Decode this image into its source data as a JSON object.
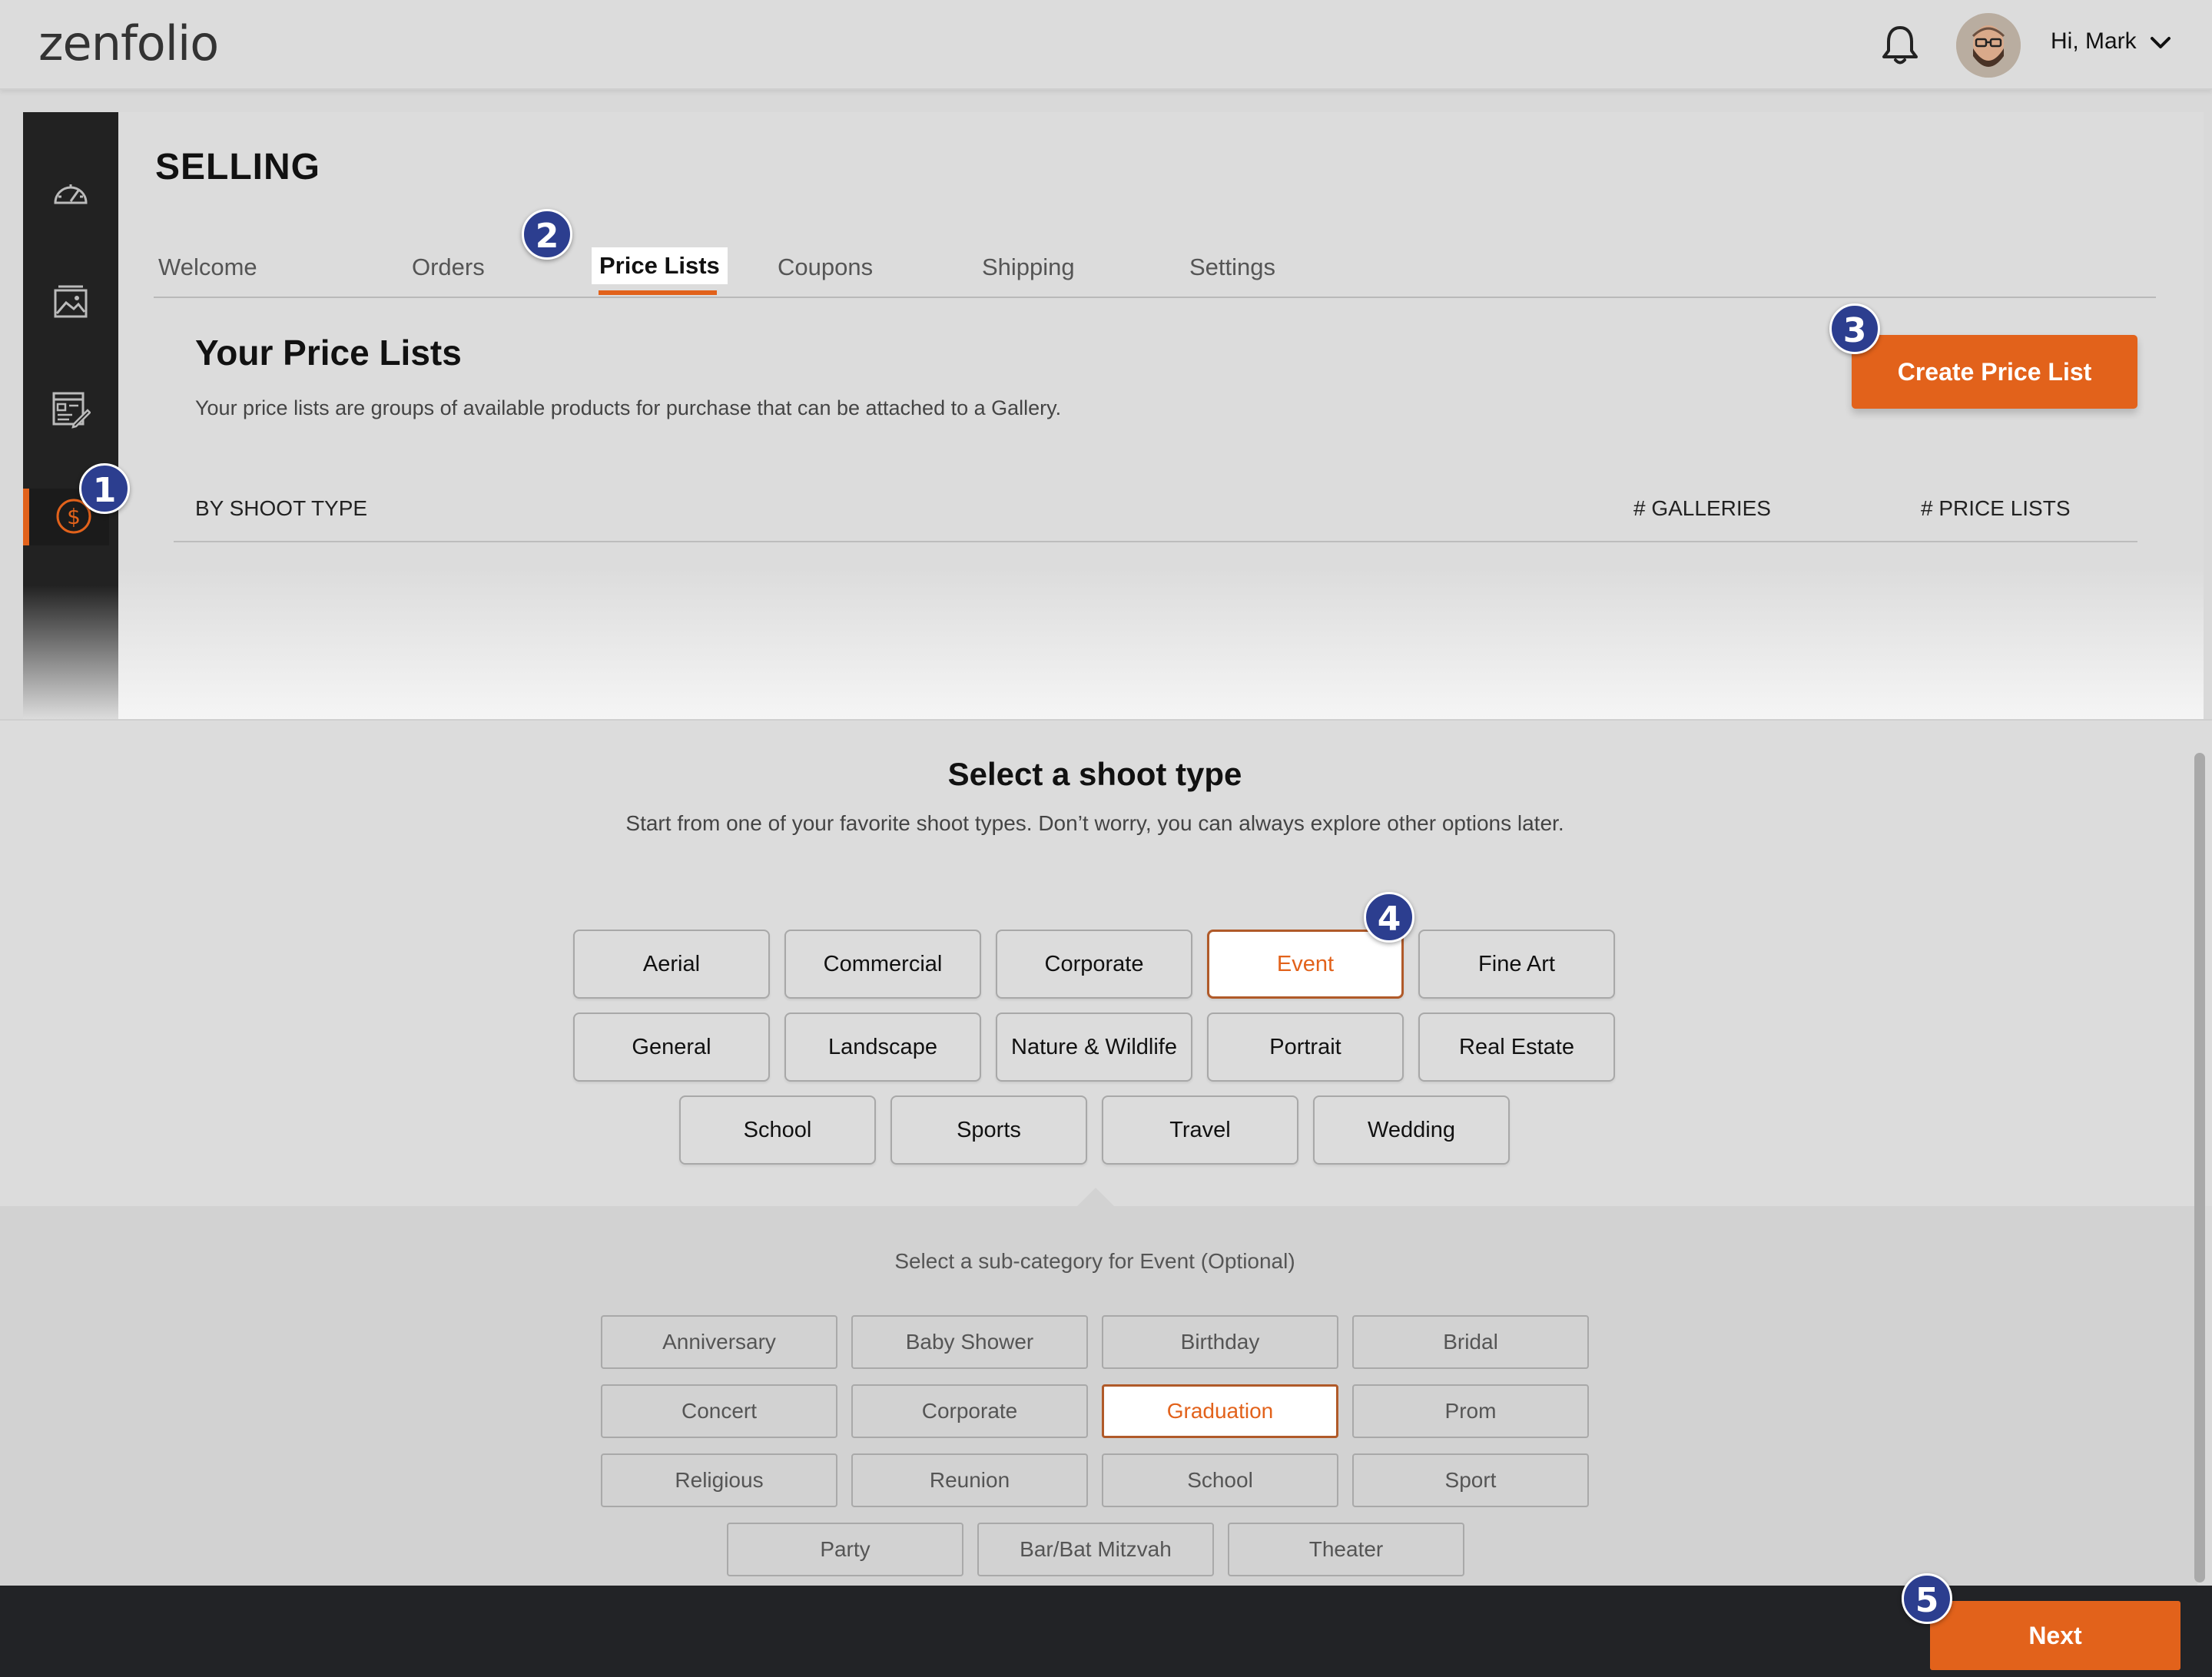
{
  "header": {
    "logo": "zenfolio",
    "greeting": "Hi, Mark",
    "icons": [
      "bell-icon",
      "avatar",
      "chevron-down-icon"
    ]
  },
  "sidebar": {
    "items": [
      {
        "icon": "dashboard-gauge-icon"
      },
      {
        "icon": "gallery-image-icon"
      },
      {
        "icon": "website-edit-icon"
      },
      {
        "icon": "dollar-selling-icon",
        "active": true
      }
    ]
  },
  "main": {
    "title": "SELLING",
    "tabs": [
      "Welcome",
      "Orders",
      "Price Lists",
      "Coupons",
      "Shipping",
      "Settings"
    ],
    "active_tab": "Price Lists",
    "section_title": "Your Price Lists",
    "section_desc": "Your price lists are groups of available products for purchase that can be attached to a Gallery.",
    "create_button": "Create Price List",
    "table_headers": [
      "BY SHOOT TYPE",
      "# GALLERIES",
      "# PRICE LISTS"
    ]
  },
  "callouts": [
    "1",
    "2",
    "3",
    "4",
    "5"
  ],
  "shoot": {
    "title": "Select a shoot type",
    "subtitle": "Start from one of your favorite shoot types. Don’t worry, you can always explore other options later.",
    "types": [
      "Aerial",
      "Commercial",
      "Corporate",
      "Event",
      "Fine Art",
      "General",
      "Landscape",
      "Nature & Wildlife",
      "Portrait",
      "Real Estate",
      "School",
      "Sports",
      "Travel",
      "Wedding"
    ],
    "selected": "Event"
  },
  "subcategory": {
    "title": "Select a sub-category for Event (Optional)",
    "items": [
      "Anniversary",
      "Baby Shower",
      "Birthday",
      "Bridal",
      "Concert",
      "Corporate",
      "Graduation",
      "Prom",
      "Religious",
      "Reunion",
      "School",
      "Sport",
      "Party",
      "Bar/Bat Mitzvah",
      "Theater"
    ],
    "selected": "Graduation"
  },
  "footer": {
    "next_button": "Next"
  },
  "colors": {
    "accent": "#e2621b",
    "callout": "#2c3e8f",
    "sidebar": "#222222",
    "footer": "#222326"
  }
}
